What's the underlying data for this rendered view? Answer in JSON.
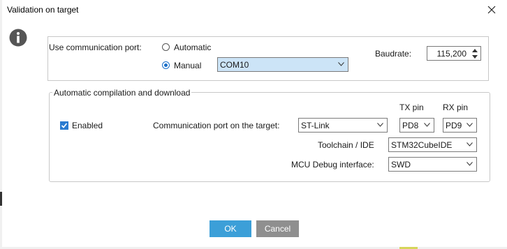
{
  "window": {
    "title": "Validation on target"
  },
  "port_section": {
    "label": "Use communication port:",
    "options": [
      {
        "label": "Automatic",
        "checked": false
      },
      {
        "label": "Manual",
        "checked": true
      }
    ],
    "port_value": "COM10",
    "baudrate_label": "Baudrate:",
    "baudrate_value": "115,200"
  },
  "auto_section": {
    "title": "Automatic compilation and download",
    "enabled_label": "Enabled",
    "enabled_checked": true,
    "tx_header": "TX pin",
    "rx_header": "RX pin",
    "comm_port_label": "Communication port on the target:",
    "comm_port_value": "ST-Link",
    "tx_value": "PD8",
    "rx_value": "PD9",
    "toolchain_label": "Toolchain / IDE",
    "toolchain_value": "STM32CubeIDE",
    "debug_label": "MCU Debug interface:",
    "debug_value": "SWD"
  },
  "buttons": {
    "ok": "OK",
    "cancel": "Cancel"
  },
  "colors": {
    "accent": "#1a6fc9",
    "ok_button": "#3c9fd8",
    "cancel_button": "#8f8f8f",
    "info_icon": "#555555"
  }
}
